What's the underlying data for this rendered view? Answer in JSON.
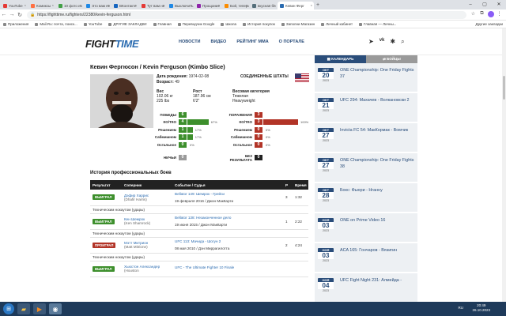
{
  "browser": {
    "tabs": [
      {
        "label": "YouTube",
        "color": "#e53935"
      },
      {
        "label": "Комиксы",
        "color": "#ff7043"
      },
      {
        "label": "10 фото из",
        "color": "#43a047"
      },
      {
        "label": "Это вам не",
        "color": "#1e88e5"
      },
      {
        "label": "ВКонтакте",
        "color": "#1565c0"
      },
      {
        "label": "Тут вам не",
        "color": "#e53935"
      },
      {
        "label": "Выключить",
        "color": "#1e88e5"
      },
      {
        "label": "Прощание",
        "color": "#8e24aa"
      },
      {
        "label": "Бой, теперь",
        "color": "#fb8c00"
      },
      {
        "label": "вкусная бо",
        "color": "#546e7a"
      },
      {
        "label": "Кевин Ферг",
        "color": "#2a6bb0",
        "active": true
      }
    ],
    "new_tab": "+",
    "url": "https://fighttime.ru/fighters/22380/kevin-ferguson.html",
    "bookmarks": [
      "Приложения",
      "Mail.Ru: почта, поиск...",
      "YouTube",
      "ДРУГИЕ ЗАКЛАДКИ",
      "Главная",
      "Переводчик Google",
      "Школа",
      "История покупок",
      "Заполни Магазин",
      "Личный кабинет",
      "Главная — Личны..."
    ],
    "bookmarks_right": [
      "Другие закладки"
    ]
  },
  "site": {
    "logo_part1": "FIGHT",
    "logo_part2": "TIME",
    "nav": [
      "НОВОСТИ",
      "ВИДЕО",
      "РЕЙТИНГ ММА",
      "О ПОРТАЛЕ"
    ]
  },
  "fighter": {
    "name": "Кевин Фергюсон / Kevin Ferguson (Kimbo Slice)",
    "birth_label": "Дата рождения:",
    "birth": "1974-02-08",
    "age_label": "Возраст:",
    "age": "49",
    "country": "СОЕДИНЕННЫЕ ШТАТЫ",
    "weight_h": "Вес",
    "weight_kg": "102.06 кг",
    "weight_lbs": "225 lbs",
    "height_h": "Рост",
    "height_cm": "187.96 см",
    "height_ft": "6'2\"",
    "class_h": "Весовая категория",
    "class_ru": "Тяжелая",
    "class_en": "Heavyweight"
  },
  "record": {
    "wins_label": "ПОБЕДЫ",
    "wins": "6",
    "losses_label": "ПОРАЖЕНИЯ",
    "losses": "3",
    "w_rows": [
      {
        "label": "КО/ТКО",
        "n": "4",
        "pct": "67%",
        "frac": 0.67
      },
      {
        "label": "Решением",
        "n": "1",
        "pct": "17%",
        "frac": 0.17
      },
      {
        "label": "Сабмишном",
        "n": "1",
        "pct": "17%",
        "frac": 0.17
      },
      {
        "label": "Остальное",
        "n": "0",
        "pct": "0%",
        "frac": 0
      }
    ],
    "l_rows": [
      {
        "label": "КО/ТКО",
        "n": "3",
        "pct": "100%",
        "frac": 1
      },
      {
        "label": "Решением",
        "n": "0",
        "pct": "0%",
        "frac": 0
      },
      {
        "label": "Сабмишном",
        "n": "0",
        "pct": "0%",
        "frac": 0
      },
      {
        "label": "Остальное",
        "n": "0",
        "pct": "0%",
        "frac": 0
      }
    ],
    "draws_label": "НИЧЬИ",
    "draws": "0",
    "nc_label": "БЕЗ РЕЗУЛЬТАТА",
    "nc": "0"
  },
  "history": {
    "title": "История профессиональных боев",
    "headers": [
      "Результат",
      "Соперник",
      "Событие / Судья",
      "Р",
      "Время"
    ],
    "rows": [
      {
        "result": "ВЫИГРАЛ",
        "type": "win",
        "opp": "Дэфир Харрис",
        "opp_en": "(Dhafir Harris)",
        "event": "Bellator 149: Шемрок - Грейси",
        "date": "19 февраля 2016 / Джон МакКарти",
        "method": "Техническим нокаутом (удары)",
        "round": "3",
        "time": "1:32"
      },
      {
        "result": "ВЫИГРАЛ",
        "type": "win",
        "opp": "Кен Шемрок",
        "opp_en": "(Ken Shamrock)",
        "event": "Bellator 138: Незаконченное дело",
        "date": "19 июня 2015 / Джон МакКарти",
        "method": "Техническим нокаутом (удары)",
        "round": "1",
        "time": "2:22"
      },
      {
        "result": "ПРОИГРАЛ",
        "type": "loss",
        "opp": "Мэтт Митрион",
        "opp_en": "(Matt Mitrione)",
        "event": "UFC 113: Мачида - Шогун 2",
        "date": "08 мая 2010 / Дэн Миррагилотта",
        "method": "Техническим нокаутом (удары)",
        "round": "2",
        "time": "4:24"
      },
      {
        "result": "ВЫИГРАЛ",
        "type": "win",
        "opp": "Хьюстон Александер",
        "opp_en": "(Houston",
        "event": "UFC - The Ultimate Fighter 10 Finale",
        "date": "",
        "method": "",
        "round": "",
        "time": ""
      }
    ]
  },
  "sidebar": {
    "tab_calendar": "КАЛЕНДАРЬ",
    "tab_fights": "БОЙЦЫ",
    "events": [
      {
        "mon": "ОКТ",
        "day": "20",
        "year": "2023",
        "title": "ONE Championship: One Friday Fights 37"
      },
      {
        "mon": "ОКТ",
        "day": "21",
        "year": "2023",
        "title": "UFC 294: Махачев - Волкановски 2"
      },
      {
        "mon": "ОКТ",
        "day": "27",
        "year": "2023",
        "title": "Invicta FC 54: МакКормак - Вомчик"
      },
      {
        "mon": "ОКТ",
        "day": "27",
        "year": "2023",
        "title": "ONE Championship: One Friday Fights 38"
      },
      {
        "mon": "ОКТ",
        "day": "28",
        "year": "2023",
        "title": "Бокс: Фьюри - Нганну"
      },
      {
        "mon": "НОЯ",
        "day": "03",
        "year": "2023",
        "title": "ONE on Prime Video 16"
      },
      {
        "mon": "НОЯ",
        "day": "03",
        "year": "2023",
        "title": "ACA 165: Гончаров - Вязигин"
      },
      {
        "mon": "НОЯ",
        "day": "04",
        "year": "2023",
        "title": "UFC Fight Night 231: Алмейда -"
      }
    ]
  },
  "taskbar": {
    "lang": "RU",
    "time": "20:49",
    "date": "26.10.2023"
  }
}
